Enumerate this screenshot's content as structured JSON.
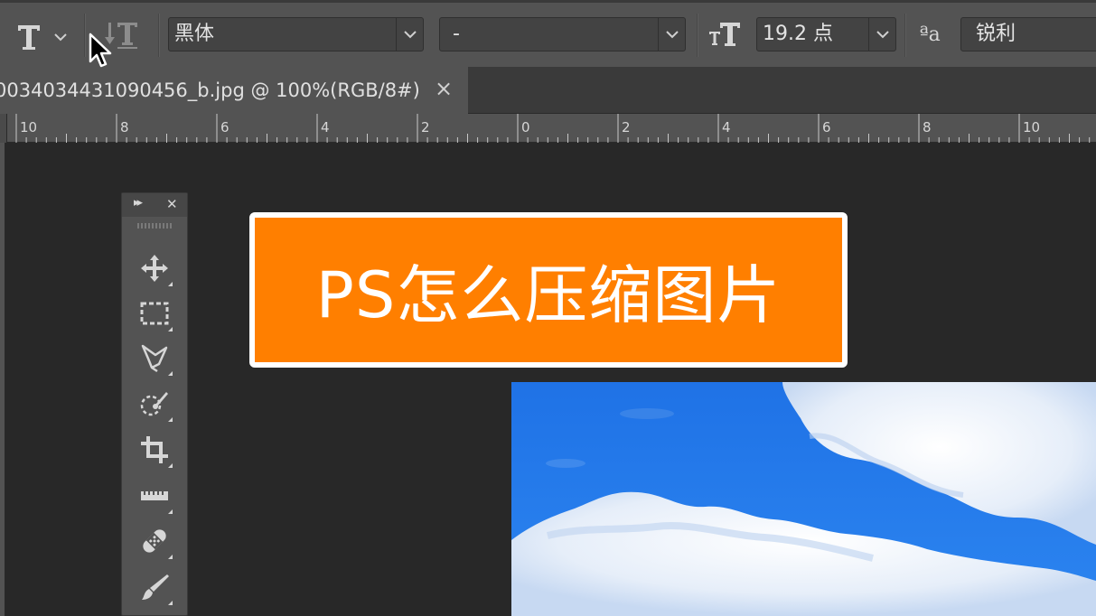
{
  "options_bar": {
    "tool_icon": "type-tool-icon",
    "orientation_icon": "toggle-text-orientation-icon",
    "font_family": "黑体",
    "font_style": "-",
    "size_icon": "font-size-icon",
    "font_size": "19.2 点",
    "aa_icon": "anti-alias-icon",
    "aa_icon_glyph": "ªa",
    "anti_alias": "锐利"
  },
  "document": {
    "tab_title": "0034034431090456_b.jpg @ 100%(RGB/8#)",
    "close_glyph": "×"
  },
  "ruler": {
    "labels": [
      "10",
      "8",
      "6",
      "4",
      "2",
      "0",
      "2",
      "4",
      "6",
      "8",
      "10"
    ]
  },
  "tools_panel": {
    "collapse_glyph": "▸▸",
    "close_glyph": "✕",
    "tools": [
      {
        "name": "move-tool",
        "icon": "move-icon"
      },
      {
        "name": "rectangular-marquee-tool",
        "icon": "marquee-icon"
      },
      {
        "name": "polygonal-lasso-tool",
        "icon": "lasso-icon"
      },
      {
        "name": "quick-selection-tool",
        "icon": "quick-selection-icon"
      },
      {
        "name": "crop-tool",
        "icon": "crop-icon"
      },
      {
        "name": "ruler-tool",
        "icon": "ruler-icon"
      },
      {
        "name": "healing-brush-tool",
        "icon": "bandage-icon"
      },
      {
        "name": "brush-tool",
        "icon": "brush-icon"
      }
    ]
  },
  "banner": {
    "text": "PS怎么压缩图片",
    "background": "#ff7f00",
    "border": "#ffffff"
  },
  "image": {
    "description_icon": "sky-clouds-image"
  }
}
